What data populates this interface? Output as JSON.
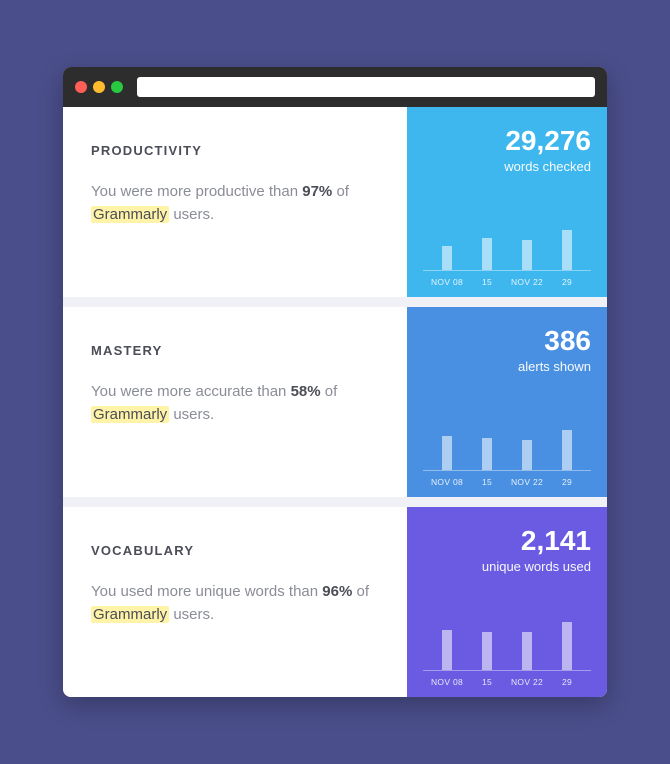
{
  "chart_data": [
    {
      "type": "bar",
      "title": "Productivity — words checked",
      "categories": [
        "NOV 08",
        "15",
        "NOV 22",
        "29"
      ],
      "values": [
        24,
        32,
        30,
        40
      ],
      "ylim": [
        0,
        52
      ],
      "xlabel": "",
      "ylabel": ""
    },
    {
      "type": "bar",
      "title": "Mastery — alerts shown",
      "categories": [
        "NOV 08",
        "15",
        "NOV 22",
        "29"
      ],
      "values": [
        34,
        32,
        30,
        40
      ],
      "ylim": [
        0,
        52
      ],
      "xlabel": "",
      "ylabel": ""
    },
    {
      "type": "bar",
      "title": "Vocabulary — unique words used",
      "categories": [
        "NOV 08",
        "15",
        "NOV 22",
        "29"
      ],
      "values": [
        40,
        38,
        38,
        48
      ],
      "ylim": [
        0,
        52
      ],
      "xlabel": "",
      "ylabel": ""
    }
  ],
  "cards": [
    {
      "title": "PRODUCTIVITY",
      "pre": "You were more productive than ",
      "pct": "97%",
      "mid": " of ",
      "brand": "Grammarly",
      "post": " users.",
      "value": "29,276",
      "caption": "words checked",
      "color": "bg-productivity"
    },
    {
      "title": "MASTERY",
      "pre": "You were more accurate than ",
      "pct": "58%",
      "mid": " of ",
      "brand": "Grammarly",
      "post": " users.",
      "value": "386",
      "caption": "alerts shown",
      "color": "bg-mastery"
    },
    {
      "title": "VOCABULARY",
      "pre": "You used more unique words than ",
      "pct": "96%",
      "mid": " of ",
      "brand": "Grammarly",
      "post": " users.",
      "value": "2,141",
      "caption": "unique words used",
      "color": "bg-vocabulary"
    }
  ]
}
